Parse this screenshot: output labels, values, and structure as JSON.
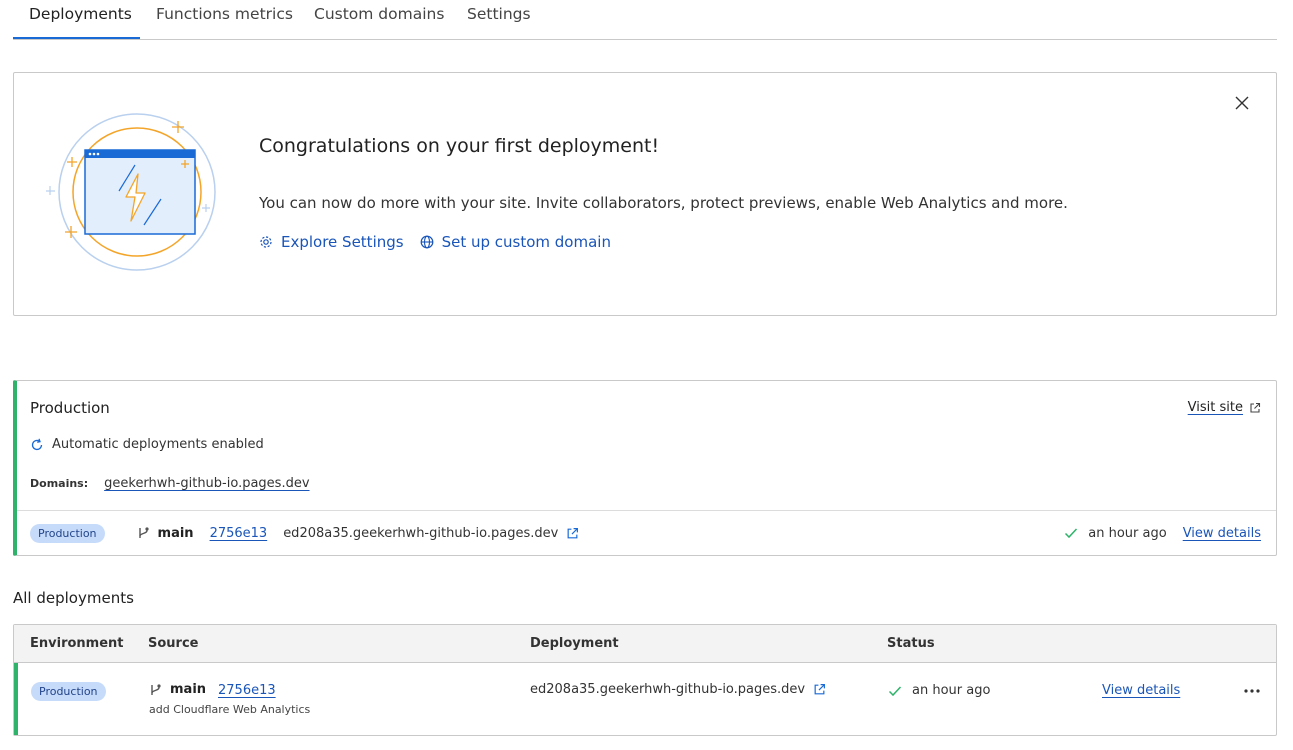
{
  "tabs": [
    {
      "label": "Deployments",
      "active": true
    },
    {
      "label": "Functions metrics",
      "active": false
    },
    {
      "label": "Custom domains",
      "active": false
    },
    {
      "label": "Settings",
      "active": false
    }
  ],
  "banner": {
    "title": "Congratulations on your first deployment!",
    "text": "You can now do more with your site. Invite collaborators, protect previews, enable Web Analytics and more.",
    "links": [
      {
        "label": "Explore Settings",
        "icon": "gear-icon"
      },
      {
        "label": "Set up custom domain",
        "icon": "globe-icon"
      }
    ]
  },
  "production": {
    "title": "Production",
    "visit_label": "Visit site",
    "auto_label": "Automatic deployments enabled",
    "domains_label": "Domains:",
    "domain": "geekerhwh-github-io.pages.dev",
    "row": {
      "environment": "Production",
      "branch": "main",
      "commit": "2756e13",
      "deployment_url": "ed208a35.geekerhwh-github-io.pages.dev",
      "status_time": "an hour ago",
      "view_label": "View details"
    }
  },
  "all_deployments": {
    "title": "All deployments",
    "columns": [
      "Environment",
      "Source",
      "Deployment",
      "Status"
    ],
    "rows": [
      {
        "environment": "Production",
        "branch": "main",
        "commit": "2756e13",
        "message": "add Cloudflare Web Analytics",
        "deployment_url": "ed208a35.geekerhwh-github-io.pages.dev",
        "status_time": "an hour ago",
        "view_label": "View details"
      }
    ]
  },
  "colors": {
    "accent": "#1a6ad6",
    "link": "#1a55b8",
    "production_bar": "#2fb36a",
    "badge_bg": "#c6dbfa",
    "illustration_orange": "#f3a52a"
  }
}
